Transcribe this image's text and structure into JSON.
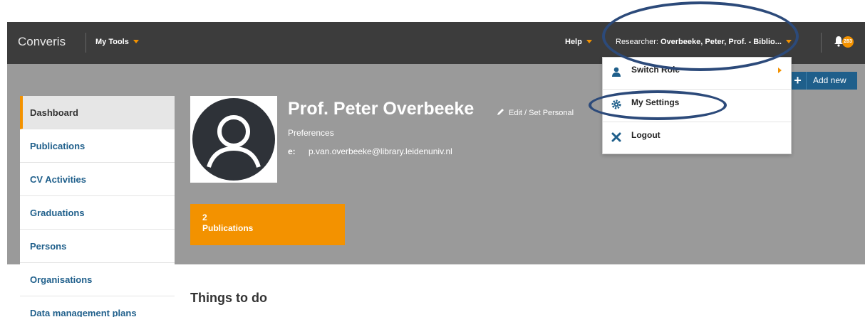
{
  "topbar": {
    "logo": "Converis",
    "my_tools": "My Tools",
    "help": "Help",
    "researcher_prefix": "Researcher: ",
    "researcher_name": "Overbeeke, Peter, Prof. - Biblio...",
    "notifications_count": "283"
  },
  "sidebar": {
    "items": [
      {
        "label": "Dashboard",
        "active": true
      },
      {
        "label": "Publications"
      },
      {
        "label": "CV Activities"
      },
      {
        "label": "Graduations"
      },
      {
        "label": "Persons"
      },
      {
        "label": "Organisations"
      },
      {
        "label": "Data management plans"
      }
    ]
  },
  "profile": {
    "name": "Prof. Peter Overbeeke",
    "edit_link": "Edit / Set Personal",
    "preferences": "Preferences",
    "email_label": "e:",
    "email": "p.van.overbeeke@library.leidenuniv.nl"
  },
  "tiles": {
    "publications_count": "2",
    "publications_label": "Publications"
  },
  "add_new": {
    "label": "Add new",
    "icon": "plus-icon"
  },
  "main": {
    "things_to_do": "Things to do"
  },
  "dropdown": {
    "items": [
      {
        "label": "Switch Role",
        "icon": "user-icon"
      },
      {
        "label": "My Settings",
        "icon": "gear-icon"
      },
      {
        "label": "Logout",
        "icon": "close-icon"
      }
    ]
  },
  "colors": {
    "accent": "#f39200",
    "nav": "#3c3c3c",
    "band": "#9a9a9a",
    "link": "#1f5f8b",
    "annotation": "#2c4a7a"
  }
}
